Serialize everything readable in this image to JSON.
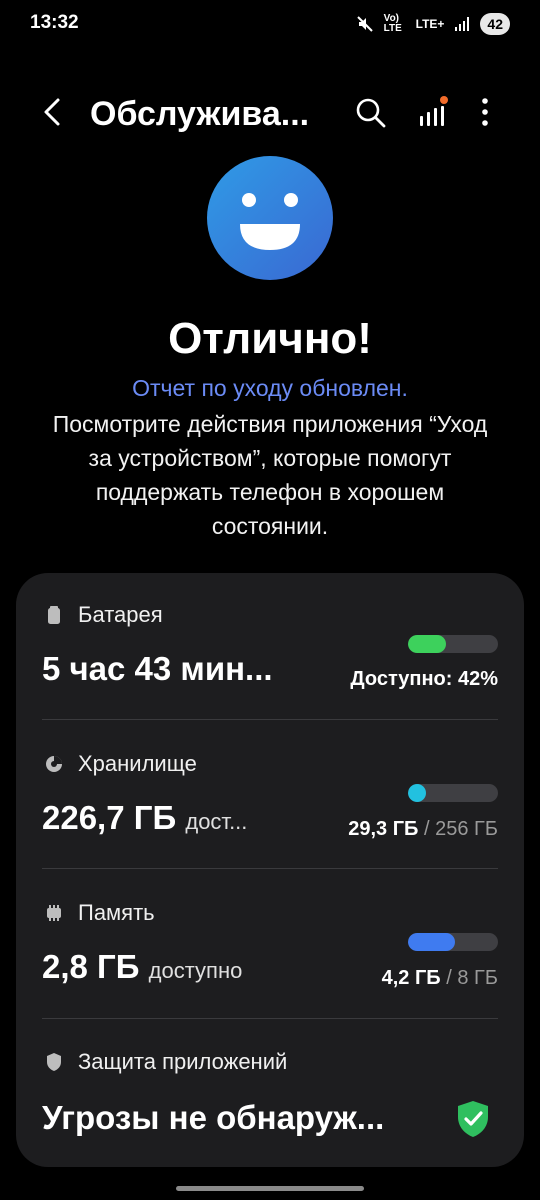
{
  "status_bar": {
    "time": "13:32",
    "vol_lte": "Vo) LTE",
    "lte_plus": "LTE+",
    "battery": "42",
    "icons": [
      "mute-icon",
      "volte-icon",
      "lte-plus-icon",
      "signal-icon",
      "battery-icon"
    ]
  },
  "header": {
    "title": "Обслужива...",
    "icons": [
      "back-icon",
      "search-icon",
      "stats-icon",
      "more-icon"
    ],
    "badge_color": "#f26b2a"
  },
  "hero": {
    "face_icon": "smiley-face-icon",
    "face_colors": [
      "#2f8de4",
      "#3b70d6"
    ],
    "title": "Отлично!",
    "report_updated": "Отчет по уходу обновлен.",
    "description": "Посмотрите действия приложения “Уход за устройством”, которые помогут поддержать телефон в хорошем состоянии."
  },
  "card": {
    "battery": {
      "label": "Батарея",
      "icon": "battery-icon",
      "value": "5 час 43 мин...",
      "right_text": "Доступно: 42%",
      "level": 0.42,
      "color": "#3dd15c"
    },
    "storage": {
      "label": "Хранилище",
      "icon": "storage-pie-icon",
      "value": "226,7 ГБ",
      "value_unit": "дост...",
      "used": "29,3 ГБ",
      "slash": "/",
      "total": "256 ГБ",
      "level": 0.11,
      "color": "#22c1e0"
    },
    "memory": {
      "label": "Память",
      "icon": "memory-chip-icon",
      "value": "2,8 ГБ",
      "value_unit": "доступно",
      "used": "4,2 ГБ",
      "slash": "/",
      "total": "8 ГБ",
      "level": 0.525,
      "color": "#3f7bf0"
    },
    "protection": {
      "label": "Защита приложений",
      "icon": "shield-icon",
      "value": "Угрозы не обнаруж...",
      "status_icon": "shield-check-icon",
      "color": "#2fbf5f"
    }
  }
}
